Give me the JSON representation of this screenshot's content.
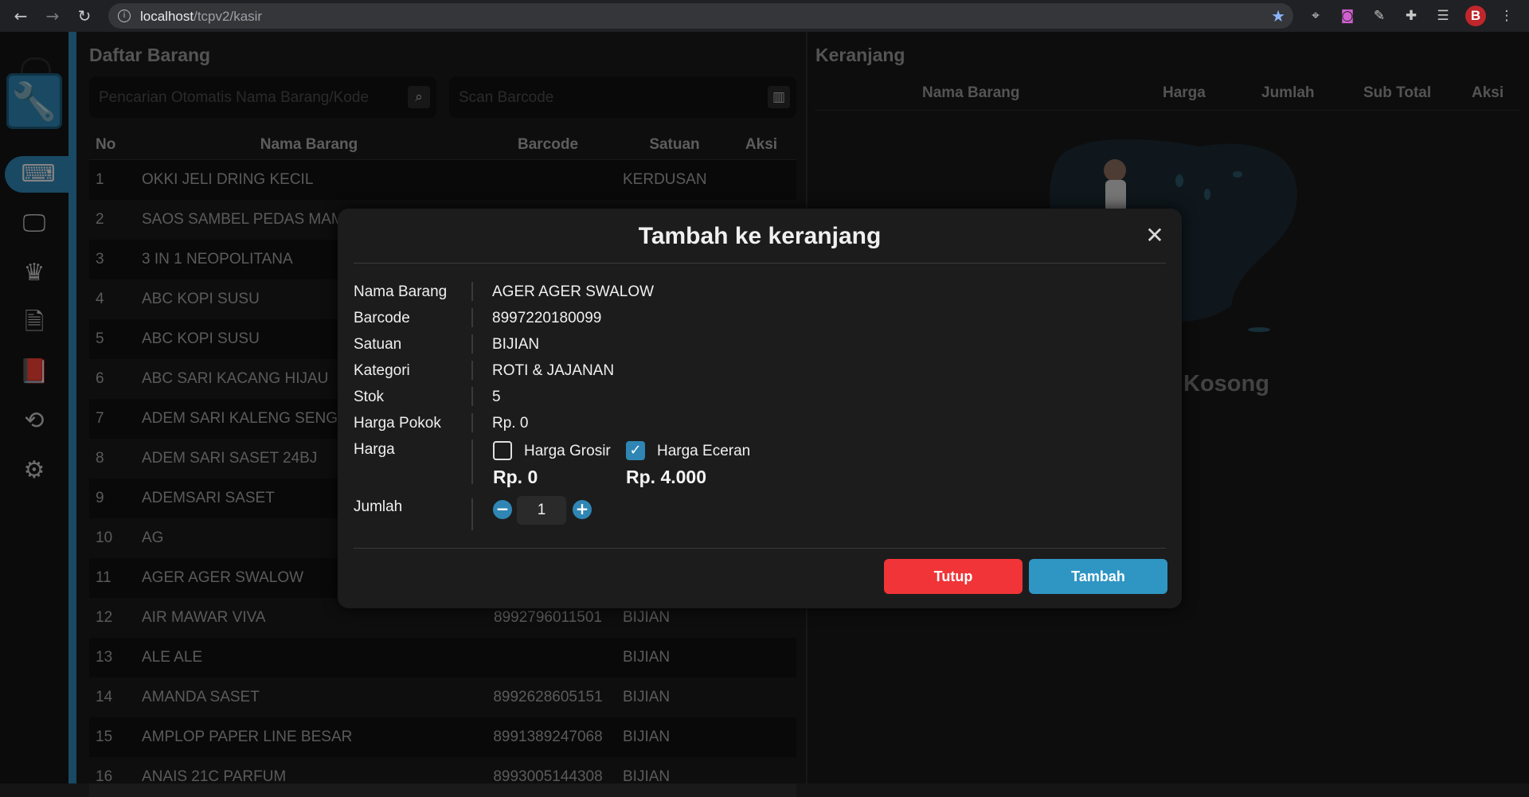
{
  "browser": {
    "url_host": "localhost",
    "url_path": "/tcpv2/kasir",
    "profile_initial": "B"
  },
  "sidebar": {
    "items": [
      {
        "name": "cashier-icon",
        "glyph": "⌨",
        "active": true
      },
      {
        "name": "monitor-icon",
        "glyph": "🖵",
        "active": false
      },
      {
        "name": "crown-icon",
        "glyph": "♛",
        "active": false
      },
      {
        "name": "invoice-icon",
        "glyph": "🗎",
        "active": false
      },
      {
        "name": "book-icon",
        "glyph": "📕",
        "active": false
      },
      {
        "name": "history-icon",
        "glyph": "⟲",
        "active": false
      },
      {
        "name": "settings-icon",
        "glyph": "⚙",
        "active": false
      }
    ]
  },
  "left": {
    "title": "Daftar Barang",
    "search_placeholder": "Pencarian Otomatis Nama Barang/Kode",
    "barcode_placeholder": "Scan Barcode",
    "columns": [
      "No",
      "Nama Barang",
      "Barcode",
      "Satuan",
      "Aksi"
    ],
    "rows": [
      {
        "no": "1",
        "name": "OKKI JELI DRING KECIL",
        "barcode": "",
        "unit": "KERDUSAN"
      },
      {
        "no": "2",
        "name": "SAOS SAMBEL PEDAS MAMA BK",
        "barcode": "",
        "unit": ""
      },
      {
        "no": "3",
        "name": "3 IN 1 NEOPOLITANA",
        "barcode": "",
        "unit": ""
      },
      {
        "no": "4",
        "name": "ABC KOPI SUSU",
        "barcode": "",
        "unit": ""
      },
      {
        "no": "5",
        "name": "ABC KOPI SUSU",
        "barcode": "",
        "unit": ""
      },
      {
        "no": "6",
        "name": "ABC SARI KACANG HIJAU",
        "barcode": "",
        "unit": ""
      },
      {
        "no": "7",
        "name": "ADEM SARI KALENG SENG",
        "barcode": "",
        "unit": ""
      },
      {
        "no": "8",
        "name": "ADEM SARI SASET 24BJ",
        "barcode": "",
        "unit": ""
      },
      {
        "no": "9",
        "name": "ADEMSARI SASET",
        "barcode": "",
        "unit": ""
      },
      {
        "no": "10",
        "name": "AG",
        "barcode": "",
        "unit": ""
      },
      {
        "no": "11",
        "name": "AGER AGER SWALOW",
        "barcode": "",
        "unit": ""
      },
      {
        "no": "12",
        "name": "AIR MAWAR VIVA",
        "barcode": "8992796011501",
        "unit": "BIJIAN"
      },
      {
        "no": "13",
        "name": "ALE ALE",
        "barcode": "",
        "unit": "BIJIAN"
      },
      {
        "no": "14",
        "name": "AMANDA SASET",
        "barcode": "8992628605151",
        "unit": "BIJIAN"
      },
      {
        "no": "15",
        "name": "AMPLOP PAPER LINE BESAR",
        "barcode": "8991389247068",
        "unit": "BIJIAN"
      },
      {
        "no": "16",
        "name": "ANAIS 21C PARFUM",
        "barcode": "8993005144308",
        "unit": "BIJIAN"
      }
    ]
  },
  "right": {
    "title": "Keranjang",
    "columns": [
      "Nama Barang",
      "Harga",
      "Jumlah",
      "Sub Total",
      "Aksi"
    ],
    "empty_text": "Kosong"
  },
  "modal": {
    "title": "Tambah ke keranjang",
    "fields": [
      {
        "label": "Nama Barang",
        "value": "AGER AGER SWALOW"
      },
      {
        "label": "Barcode",
        "value": "8997220180099"
      },
      {
        "label": "Satuan",
        "value": "BIJIAN"
      },
      {
        "label": "Kategori",
        "value": "ROTI & JAJANAN"
      },
      {
        "label": "Stok",
        "value": "5"
      },
      {
        "label": "Harga Pokok",
        "value": "Rp. 0"
      }
    ],
    "price_label": "Harga",
    "wholesale_label": "Harga Grosir",
    "wholesale_price": "Rp. 0",
    "wholesale_checked": false,
    "retail_label": "Harga Eceran",
    "retail_price": "Rp. 4.000",
    "retail_checked": true,
    "qty_label": "Jumlah",
    "qty_value": "1",
    "close_label": "Tutup",
    "add_label": "Tambah",
    "close_color": "#f03438",
    "add_color": "#2f96c4"
  }
}
